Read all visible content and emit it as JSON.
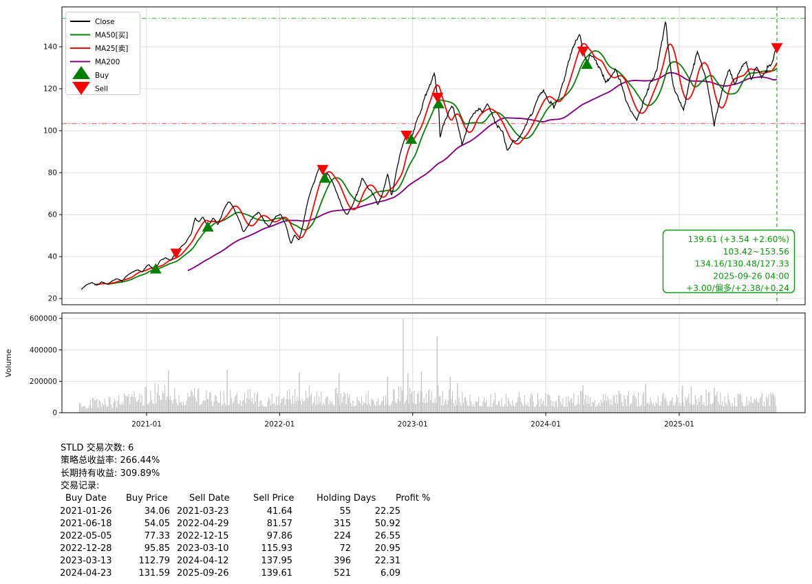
{
  "stats": {
    "line1": "STLD 交易次数: 6",
    "line2": "策略总收益率: 266.44%",
    "line3": "长期持有收益: 309.89%",
    "line4": "交易记录:"
  },
  "trade_table": {
    "headers": [
      "Buy Date",
      "Buy Price",
      "Sell Date",
      "Sell Price",
      "Holding Days",
      "Profit %"
    ],
    "rows": [
      [
        "2021-01-26",
        "34.06",
        "2021-03-23",
        "41.64",
        "55",
        "22.25"
      ],
      [
        "2021-06-18",
        "54.05",
        "2022-04-29",
        "81.57",
        "315",
        "50.92"
      ],
      [
        "2022-05-05",
        "77.33",
        "2022-12-15",
        "97.86",
        "224",
        "26.55"
      ],
      [
        "2022-12-28",
        "95.85",
        "2023-03-10",
        "115.93",
        "72",
        "20.95"
      ],
      [
        "2023-03-13",
        "112.79",
        "2024-04-12",
        "137.95",
        "396",
        "22.31"
      ],
      [
        "2024-04-23",
        "131.59",
        "2025-09-26",
        "139.61",
        "521",
        "6.09"
      ]
    ]
  },
  "chart_data": {
    "type": "line",
    "symbol": "STLD",
    "x_range": [
      "2020-07-06",
      "2025-09-26"
    ],
    "xticks": [
      {
        "date": "2021-01-01",
        "label": "2021-01"
      },
      {
        "date": "2022-01-01",
        "label": "2022-01"
      },
      {
        "date": "2023-01-01",
        "label": "2023-01"
      },
      {
        "date": "2024-01-01",
        "label": "2024-01"
      },
      {
        "date": "2025-01-01",
        "label": "2025-01"
      }
    ],
    "price_panel": {
      "ylim": [
        17,
        159
      ],
      "yticks": [
        20,
        40,
        60,
        80,
        100,
        120,
        140
      ],
      "grid": true,
      "legend": [
        {
          "label": "Close",
          "color": "#000000",
          "kind": "line"
        },
        {
          "label": "MA50[买]",
          "color": "#007f00",
          "kind": "line"
        },
        {
          "label": "MA25[卖]",
          "color": "#ff0000",
          "kind": "line"
        },
        {
          "label": "MA200",
          "color": "#800080",
          "kind": "line"
        },
        {
          "label": "Buy",
          "color": "#007f00",
          "kind": "triangle-up"
        },
        {
          "label": "Sell",
          "color": "#ff0000",
          "kind": "triangle-down"
        }
      ],
      "hlines": [
        {
          "value": 153.56,
          "color": "#15a315",
          "style": "dashdot"
        },
        {
          "value": 103.42,
          "color": "#ff2020",
          "style": "dashdot"
        }
      ],
      "vline": {
        "date": "2025-09-26",
        "color": "#12a012",
        "style": "dashed"
      },
      "annotation": {
        "color": "#0c9a0c",
        "lines": [
          "139.61 (+3.54 +2.60%)",
          "103.42~153.56",
          "134.16/130.48/127.33",
          "2025-09-26 04:00",
          "+3.00/偏多/+2.38/+0.24"
        ]
      },
      "ma_windows": {
        "ma25_days": 36,
        "ma50_days": 72,
        "ma200_days": 290
      },
      "buy_markers": [
        [
          "2021-01-26",
          34.06
        ],
        [
          "2021-06-18",
          54.05
        ],
        [
          "2022-05-05",
          77.33
        ],
        [
          "2022-12-28",
          95.85
        ],
        [
          "2023-03-13",
          112.79
        ],
        [
          "2024-04-23",
          131.59
        ]
      ],
      "sell_markers": [
        [
          "2021-03-23",
          41.64
        ],
        [
          "2022-04-29",
          81.57
        ],
        [
          "2022-12-15",
          97.86
        ],
        [
          "2023-03-10",
          115.93
        ],
        [
          "2024-04-12",
          137.95
        ],
        [
          "2025-09-26",
          139.61
        ]
      ],
      "close": [
        [
          "2020-07-06",
          24.6
        ],
        [
          "2020-07-20",
          26.5
        ],
        [
          "2020-08-03",
          27.5
        ],
        [
          "2020-08-17",
          26.3
        ],
        [
          "2020-08-31",
          27.8
        ],
        [
          "2020-09-14",
          26.8
        ],
        [
          "2020-09-28",
          28.2
        ],
        [
          "2020-10-12",
          29.5
        ],
        [
          "2020-10-26",
          28.4
        ],
        [
          "2020-11-09",
          31.0
        ],
        [
          "2020-11-23",
          32.5
        ],
        [
          "2020-12-07",
          33.8
        ],
        [
          "2020-12-21",
          32.8
        ],
        [
          "2021-01-06",
          36.5
        ],
        [
          "2021-01-15",
          34.8
        ],
        [
          "2021-01-26",
          34.06
        ],
        [
          "2021-02-08",
          38.0
        ],
        [
          "2021-02-22",
          39.5
        ],
        [
          "2021-03-08",
          38.2
        ],
        [
          "2021-03-23",
          41.64
        ],
        [
          "2021-04-06",
          44.5
        ],
        [
          "2021-04-20",
          47.0
        ],
        [
          "2021-05-04",
          51.0
        ],
        [
          "2021-05-14",
          58.0
        ],
        [
          "2021-05-24",
          56.5
        ],
        [
          "2021-06-04",
          59.0
        ],
        [
          "2021-06-18",
          54.05
        ],
        [
          "2021-07-02",
          58.5
        ],
        [
          "2021-07-16",
          55.5
        ],
        [
          "2021-08-02",
          63.0
        ],
        [
          "2021-08-13",
          66.5
        ],
        [
          "2021-08-27",
          63.5
        ],
        [
          "2021-09-10",
          58.0
        ],
        [
          "2021-09-24",
          51.5
        ],
        [
          "2021-10-08",
          55.5
        ],
        [
          "2021-10-22",
          59.5
        ],
        [
          "2021-11-05",
          61.5
        ],
        [
          "2021-11-19",
          57.0
        ],
        [
          "2021-12-03",
          54.5
        ],
        [
          "2021-12-17",
          58.5
        ],
        [
          "2022-01-03",
          60.5
        ],
        [
          "2022-01-18",
          55.0
        ],
        [
          "2022-02-01",
          46.0
        ],
        [
          "2022-02-11",
          50.5
        ],
        [
          "2022-02-23",
          48.0
        ],
        [
          "2022-03-07",
          56.0
        ],
        [
          "2022-03-21",
          68.0
        ],
        [
          "2022-04-04",
          74.5
        ],
        [
          "2022-04-14",
          80.5
        ],
        [
          "2022-04-22",
          83.5
        ],
        [
          "2022-04-29",
          81.57
        ],
        [
          "2022-05-05",
          77.33
        ],
        [
          "2022-05-13",
          80.0
        ],
        [
          "2022-05-27",
          75.5
        ],
        [
          "2022-06-10",
          69.0
        ],
        [
          "2022-06-24",
          62.5
        ],
        [
          "2022-07-05",
          60.0
        ],
        [
          "2022-07-19",
          63.5
        ],
        [
          "2022-08-02",
          70.5
        ],
        [
          "2022-08-16",
          77.5
        ],
        [
          "2022-08-30",
          73.0
        ],
        [
          "2022-09-13",
          70.0
        ],
        [
          "2022-09-27",
          65.0
        ],
        [
          "2022-10-11",
          70.5
        ],
        [
          "2022-10-25",
          80.0
        ],
        [
          "2022-11-04",
          68.0
        ],
        [
          "2022-11-18",
          82.0
        ],
        [
          "2022-12-02",
          92.0
        ],
        [
          "2022-12-15",
          97.86
        ],
        [
          "2022-12-28",
          95.85
        ],
        [
          "2023-01-10",
          103.0
        ],
        [
          "2023-01-24",
          110.0
        ],
        [
          "2023-02-07",
          118.0
        ],
        [
          "2023-02-21",
          124.0
        ],
        [
          "2023-03-02",
          127.5
        ],
        [
          "2023-03-10",
          115.93
        ],
        [
          "2023-03-13",
          112.79
        ],
        [
          "2023-03-17",
          97.0
        ],
        [
          "2023-03-24",
          101.0
        ],
        [
          "2023-04-07",
          108.0
        ],
        [
          "2023-04-21",
          112.0
        ],
        [
          "2023-05-02",
          104.0
        ],
        [
          "2023-05-16",
          93.5
        ],
        [
          "2023-05-30",
          101.5
        ],
        [
          "2023-06-13",
          107.0
        ],
        [
          "2023-06-27",
          110.5
        ],
        [
          "2023-07-11",
          109.0
        ],
        [
          "2023-07-25",
          112.5
        ],
        [
          "2023-08-08",
          107.0
        ],
        [
          "2023-08-22",
          102.5
        ],
        [
          "2023-09-05",
          99.0
        ],
        [
          "2023-09-19",
          90.0
        ],
        [
          "2023-10-03",
          95.0
        ],
        [
          "2023-10-17",
          96.0
        ],
        [
          "2023-10-31",
          99.5
        ],
        [
          "2023-11-14",
          105.0
        ],
        [
          "2023-11-28",
          110.0
        ],
        [
          "2023-12-12",
          116.0
        ],
        [
          "2023-12-26",
          118.5
        ],
        [
          "2024-01-09",
          114.0
        ],
        [
          "2024-01-23",
          111.5
        ],
        [
          "2024-02-06",
          117.0
        ],
        [
          "2024-02-20",
          124.0
        ],
        [
          "2024-03-05",
          133.0
        ],
        [
          "2024-03-19",
          141.0
        ],
        [
          "2024-04-03",
          146.5
        ],
        [
          "2024-04-12",
          137.95
        ],
        [
          "2024-04-23",
          131.59
        ],
        [
          "2024-05-03",
          137.0
        ],
        [
          "2024-05-17",
          133.5
        ],
        [
          "2024-05-31",
          129.0
        ],
        [
          "2024-06-14",
          122.5
        ],
        [
          "2024-06-28",
          125.5
        ],
        [
          "2024-07-12",
          129.5
        ],
        [
          "2024-07-26",
          122.0
        ],
        [
          "2024-08-09",
          113.5
        ],
        [
          "2024-08-23",
          109.0
        ],
        [
          "2024-09-06",
          105.5
        ],
        [
          "2024-09-20",
          111.0
        ],
        [
          "2024-10-04",
          118.5
        ],
        [
          "2024-10-18",
          123.5
        ],
        [
          "2024-11-01",
          129.0
        ],
        [
          "2024-11-15",
          143.0
        ],
        [
          "2024-11-25",
          153.2
        ],
        [
          "2024-12-06",
          132.0
        ],
        [
          "2024-12-17",
          120.0
        ],
        [
          "2024-12-30",
          116.0
        ],
        [
          "2025-01-13",
          110.0
        ],
        [
          "2025-01-27",
          122.0
        ],
        [
          "2025-02-10",
          132.0
        ],
        [
          "2025-02-21",
          137.0
        ],
        [
          "2025-03-10",
          128.0
        ],
        [
          "2025-03-24",
          118.0
        ],
        [
          "2025-04-07",
          102.5
        ],
        [
          "2025-04-21",
          114.0
        ],
        [
          "2025-05-05",
          123.0
        ],
        [
          "2025-05-19",
          129.0
        ],
        [
          "2025-06-02",
          122.0
        ],
        [
          "2025-06-16",
          128.0
        ],
        [
          "2025-07-03",
          133.0
        ],
        [
          "2025-07-17",
          125.0
        ],
        [
          "2025-08-01",
          130.0
        ],
        [
          "2025-08-15",
          125.5
        ],
        [
          "2025-08-29",
          129.0
        ],
        [
          "2025-09-12",
          132.5
        ],
        [
          "2025-09-26",
          139.61
        ]
      ]
    },
    "volume_panel": {
      "ylabel": "Volume",
      "ylim": [
        0,
        640000
      ],
      "yticks": [
        0,
        200000,
        400000,
        600000
      ],
      "anchors": [
        [
          "2020-07-01",
          50000
        ],
        [
          "2020-08-01",
          58000
        ],
        [
          "2020-09-01",
          70000
        ],
        [
          "2020-10-01",
          62000
        ],
        [
          "2020-11-01",
          85000
        ],
        [
          "2020-12-01",
          92000
        ],
        [
          "2021-01-01",
          105000
        ],
        [
          "2021-02-01",
          125000
        ],
        [
          "2021-03-01",
          115000
        ],
        [
          "2021-04-01",
          100000
        ],
        [
          "2021-05-01",
          112000
        ],
        [
          "2021-06-01",
          95000
        ],
        [
          "2021-07-01",
          88000
        ],
        [
          "2021-08-01",
          102000
        ],
        [
          "2021-09-01",
          92000
        ],
        [
          "2021-10-01",
          95000
        ],
        [
          "2021-11-01",
          88000
        ],
        [
          "2021-12-01",
          80000
        ],
        [
          "2022-01-01",
          92000
        ],
        [
          "2022-02-01",
          102000
        ],
        [
          "2022-03-01",
          118000
        ],
        [
          "2022-04-01",
          112000
        ],
        [
          "2022-05-01",
          108000
        ],
        [
          "2022-06-01",
          102000
        ],
        [
          "2022-07-01",
          92000
        ],
        [
          "2022-08-01",
          88000
        ],
        [
          "2022-09-01",
          92000
        ],
        [
          "2022-10-01",
          98000
        ],
        [
          "2022-11-01",
          102000
        ],
        [
          "2022-12-01",
          115000
        ],
        [
          "2023-01-01",
          108000
        ],
        [
          "2023-02-01",
          112000
        ],
        [
          "2023-03-01",
          120000
        ],
        [
          "2023-04-01",
          98000
        ],
        [
          "2023-05-01",
          92000
        ],
        [
          "2023-06-01",
          88000
        ],
        [
          "2023-07-01",
          84000
        ],
        [
          "2023-08-01",
          80000
        ],
        [
          "2023-09-01",
          84000
        ],
        [
          "2023-10-01",
          88000
        ],
        [
          "2023-11-01",
          84000
        ],
        [
          "2023-12-01",
          78000
        ],
        [
          "2024-01-01",
          84000
        ],
        [
          "2024-02-01",
          80000
        ],
        [
          "2024-03-01",
          84000
        ],
        [
          "2024-04-01",
          92000
        ],
        [
          "2024-05-01",
          84000
        ],
        [
          "2024-06-01",
          78000
        ],
        [
          "2024-07-01",
          84000
        ],
        [
          "2024-08-01",
          92000
        ],
        [
          "2024-09-01",
          88000
        ],
        [
          "2024-10-01",
          84000
        ],
        [
          "2024-11-01",
          92000
        ],
        [
          "2024-12-01",
          88000
        ],
        [
          "2025-01-01",
          96000
        ],
        [
          "2025-02-01",
          88000
        ],
        [
          "2025-03-01",
          92000
        ],
        [
          "2025-04-01",
          104000
        ],
        [
          "2025-05-01",
          88000
        ],
        [
          "2025-06-01",
          82000
        ],
        [
          "2025-07-01",
          88000
        ],
        [
          "2025-08-01",
          82000
        ],
        [
          "2025-09-26",
          90000
        ]
      ],
      "spikes": [
        [
          "2021-03-02",
          268000
        ],
        [
          "2021-08-10",
          275000
        ],
        [
          "2022-02-24",
          258000
        ],
        [
          "2022-06-13",
          252000
        ],
        [
          "2022-10-24",
          230000
        ],
        [
          "2022-12-06",
          597000
        ],
        [
          "2022-12-19",
          252000
        ],
        [
          "2023-01-25",
          262000
        ],
        [
          "2023-03-09",
          487000
        ],
        [
          "2023-04-14",
          228000
        ],
        [
          "2023-05-04",
          190000
        ],
        [
          "2024-04-12",
          175000
        ],
        [
          "2024-10-01",
          185000
        ],
        [
          "2025-01-10",
          172000
        ],
        [
          "2025-02-03",
          165000
        ],
        [
          "2025-04-07",
          160000
        ]
      ]
    }
  }
}
